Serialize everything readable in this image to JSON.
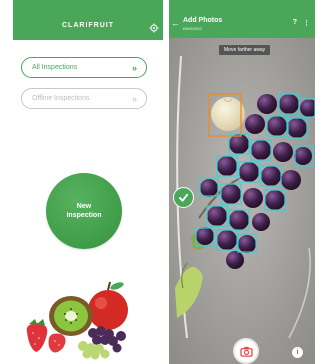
{
  "left_screen": {
    "header": {
      "logo_text": "CLARIFRUIT",
      "background": "#4aa75a",
      "settings_icon": "gear-icon"
    },
    "menu": {
      "all_inspections": {
        "label": "All Inspections",
        "chevron": "»",
        "accent": "#4aa75a"
      },
      "offline_inspections": {
        "label": "Offline Inspections",
        "chevron": "»",
        "color": "#bdbdbd"
      }
    },
    "new_inspection": {
      "line1": "New",
      "line2": "Inspection",
      "color": "#3f9c47"
    },
    "illustration": "fruit-illustration"
  },
  "right_screen": {
    "topbar": {
      "title": "Add Photos",
      "subtitle": "BN001503",
      "back_icon": "arrow-left-icon",
      "help_label": "?",
      "more_label": "⋮"
    },
    "camera_hint": "Move farther away",
    "detections": {
      "selected_color": "#f08a24",
      "detected_color": "#3ad0d8"
    },
    "controls": {
      "confirm_icon": "check-icon",
      "capture_icon": "camera-icon",
      "info_label": "i",
      "capture_color": "#e84848"
    }
  }
}
